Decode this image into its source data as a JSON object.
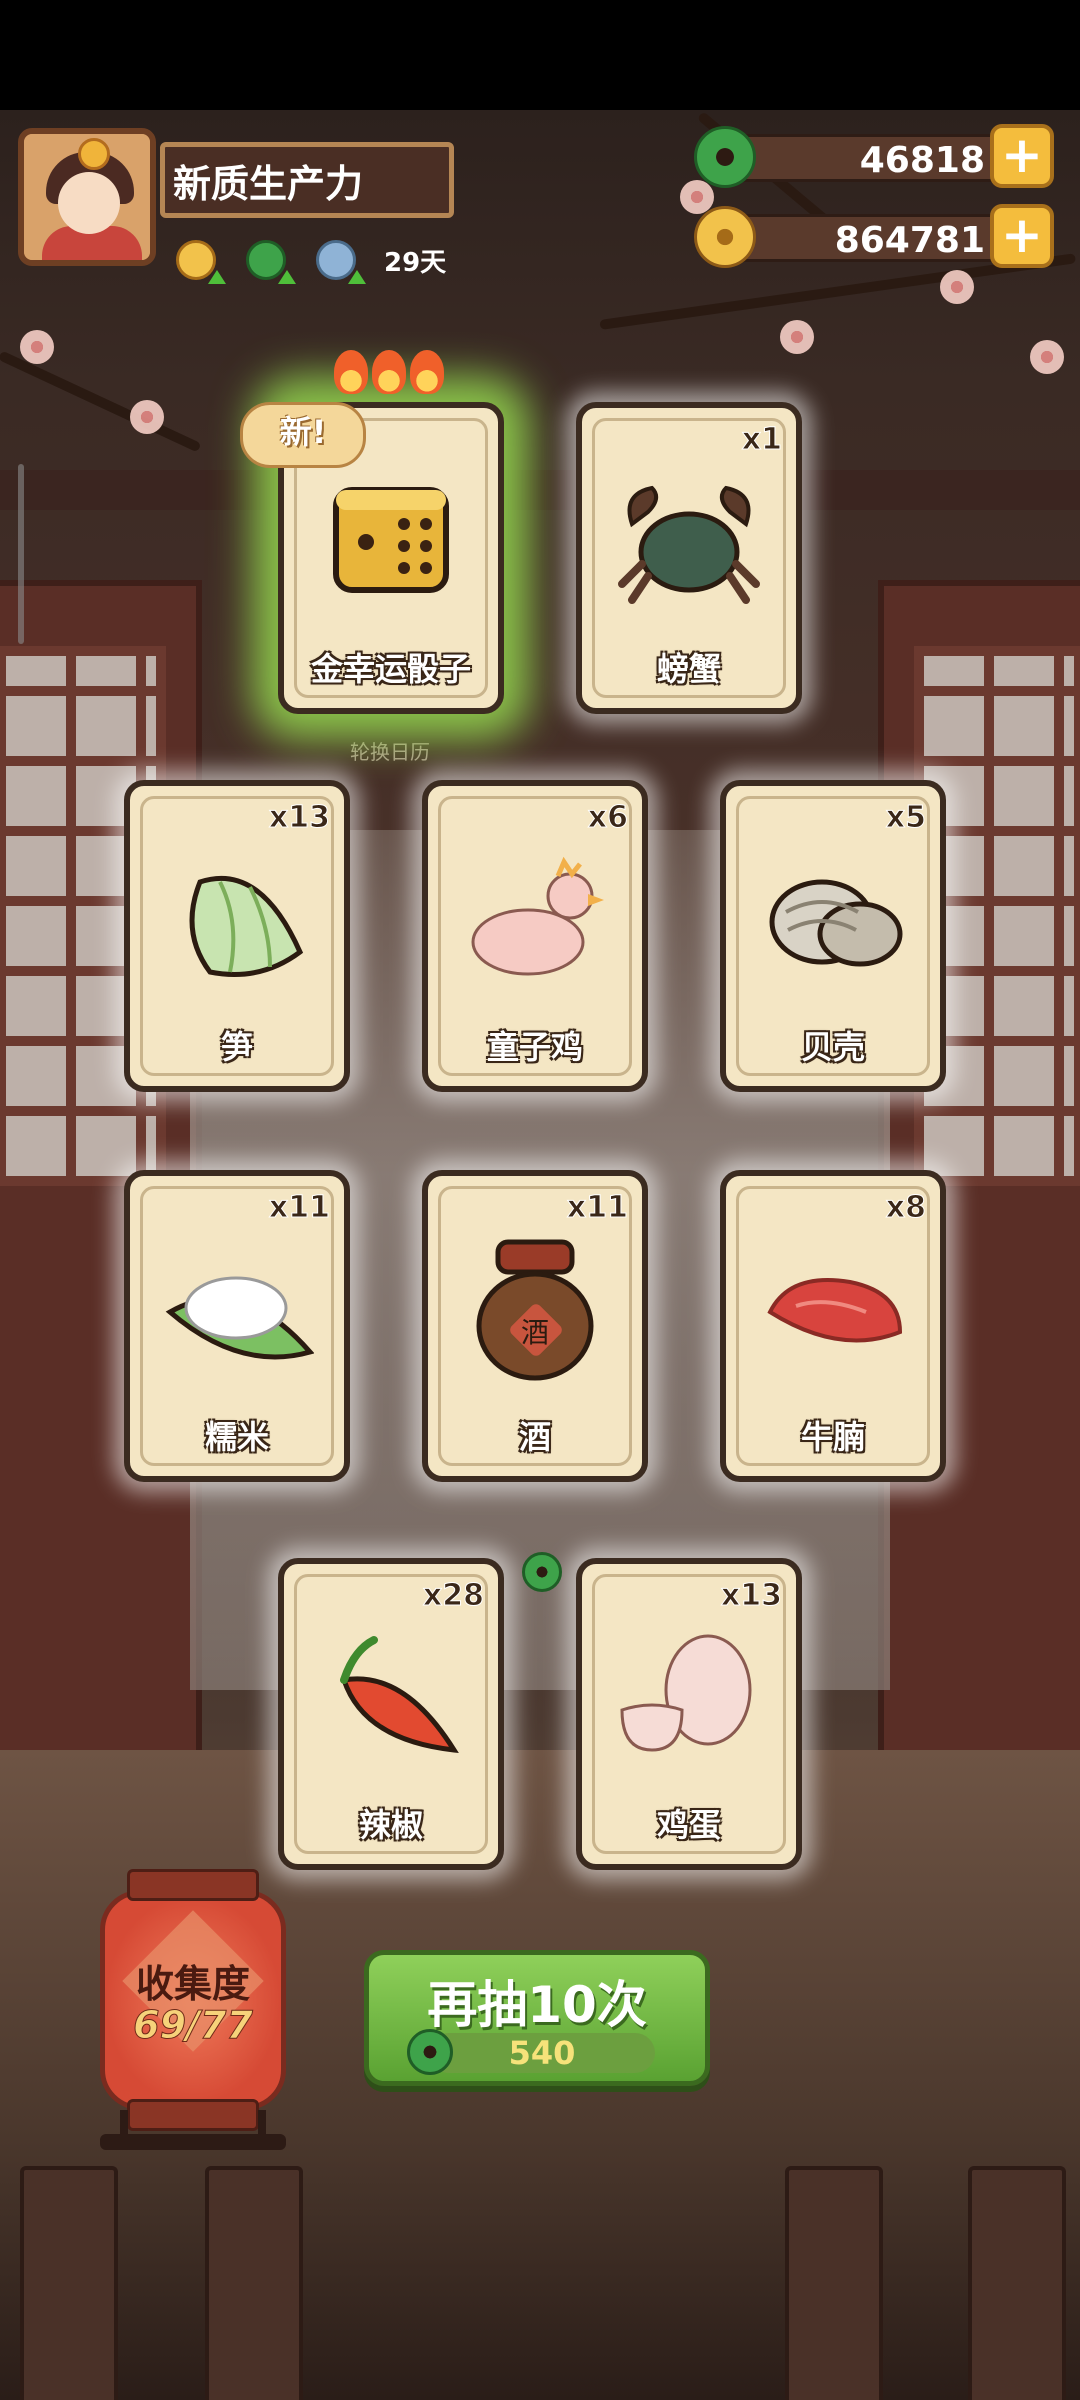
{
  "player": {
    "name": "新质生产力",
    "days": "29天",
    "status_icons": [
      "gold-ingot-boost-icon",
      "jade-boost-icon",
      "bowl-boost-icon"
    ]
  },
  "currency": {
    "jade": {
      "value": "46818",
      "plus": "+"
    },
    "coins": {
      "value": "864781",
      "plus": "+"
    }
  },
  "cards": [
    {
      "label": "金幸运骰子",
      "count": "",
      "is_new": true,
      "new_tag": "新!",
      "icon": "golden-dice-icon"
    },
    {
      "label": "螃蟹",
      "count": "x1",
      "icon": "crab-icon"
    },
    {
      "label": "笋",
      "count": "x13",
      "icon": "bamboo-shoot-icon"
    },
    {
      "label": "童子鸡",
      "count": "x6",
      "icon": "chick-icon"
    },
    {
      "label": "贝壳",
      "count": "x5",
      "icon": "shell-icon"
    },
    {
      "label": "糯米",
      "count": "x11",
      "icon": "sticky-rice-icon"
    },
    {
      "label": "酒",
      "count": "x11",
      "icon": "wine-jar-icon",
      "jar_char": "酒"
    },
    {
      "label": "牛腩",
      "count": "x8",
      "icon": "beef-icon"
    },
    {
      "label": "辣椒",
      "count": "x28",
      "icon": "chili-icon"
    },
    {
      "label": "鸡蛋",
      "count": "x13",
      "icon": "egg-icon"
    }
  ],
  "background_label": "轮换日历",
  "collection": {
    "title": "收集度",
    "progress": "69/77"
  },
  "draw_button": {
    "title": "再抽10次",
    "cost": "540"
  },
  "colors": {
    "jade": "#3ea34a",
    "gold": "#f4bd3d",
    "card": "#f4e6c4",
    "button": "#6fb843"
  }
}
